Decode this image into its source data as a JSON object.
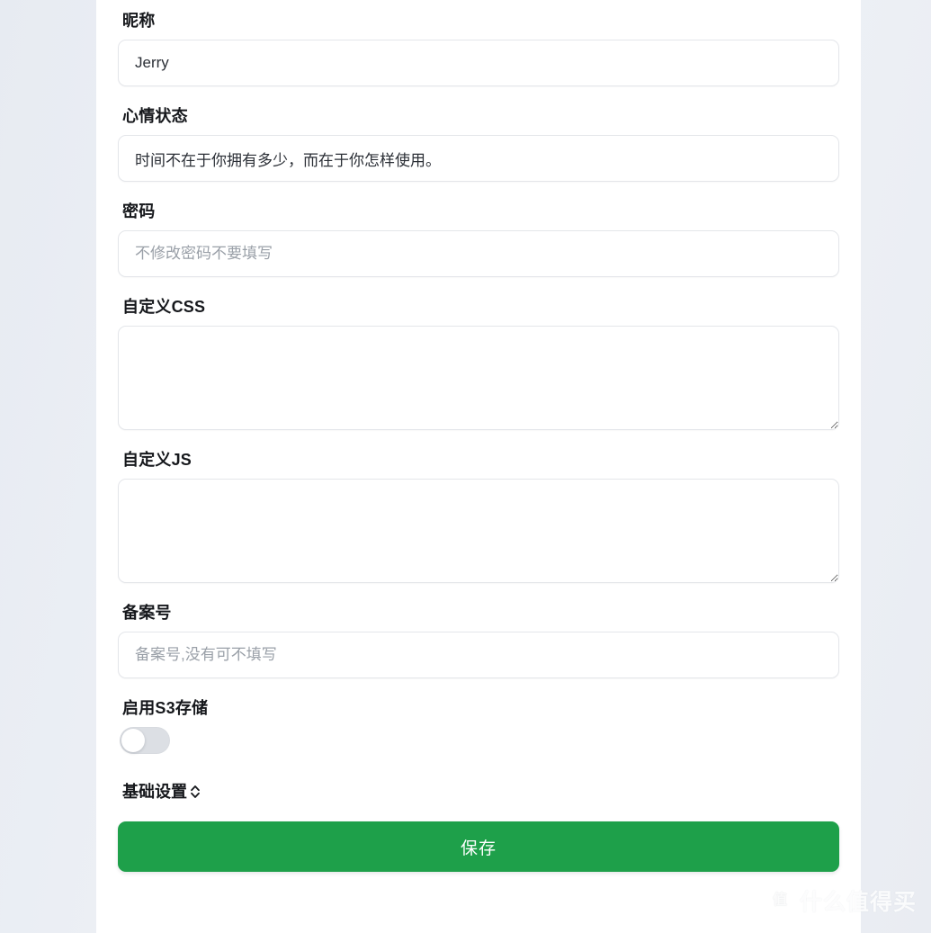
{
  "theme": {
    "page_background": "#eef1f6",
    "card_background": "#ffffff",
    "accent_green": "#1ea04a",
    "label_color": "#16181c",
    "input_border": "#e4e6ea",
    "placeholder_color": "#9aa0a8",
    "switch_off_track": "#dcdfe4"
  },
  "form": {
    "fields": [
      {
        "id": "nickname",
        "label": "昵称",
        "value": "Jerry",
        "placeholder": "",
        "type": "text"
      },
      {
        "id": "mood",
        "label": "心情状态",
        "value": "时间不在于你拥有多少，而在于你怎样使用。",
        "placeholder": "",
        "type": "text"
      },
      {
        "id": "password",
        "label": "密码",
        "value": "",
        "placeholder": "不修改密码不要填写",
        "type": "password"
      },
      {
        "id": "custom-css",
        "label": "自定义CSS",
        "value": "",
        "placeholder": "",
        "type": "textarea"
      },
      {
        "id": "custom-js",
        "label": "自定义JS",
        "value": "",
        "placeholder": "",
        "type": "textarea"
      },
      {
        "id": "icp-number",
        "label": "备案号",
        "value": "",
        "placeholder": "备案号,没有可不填写",
        "type": "text"
      }
    ],
    "s3_toggle": {
      "label": "启用S3存储",
      "enabled": false,
      "state_text": "off"
    },
    "section_toggle": {
      "label": "基础设置",
      "icon": "chevron-up-down-icon",
      "expanded": false
    },
    "save_button": {
      "label": "保存"
    }
  },
  "watermark": {
    "logo_glyph": "值",
    "text": "什么值得买"
  }
}
